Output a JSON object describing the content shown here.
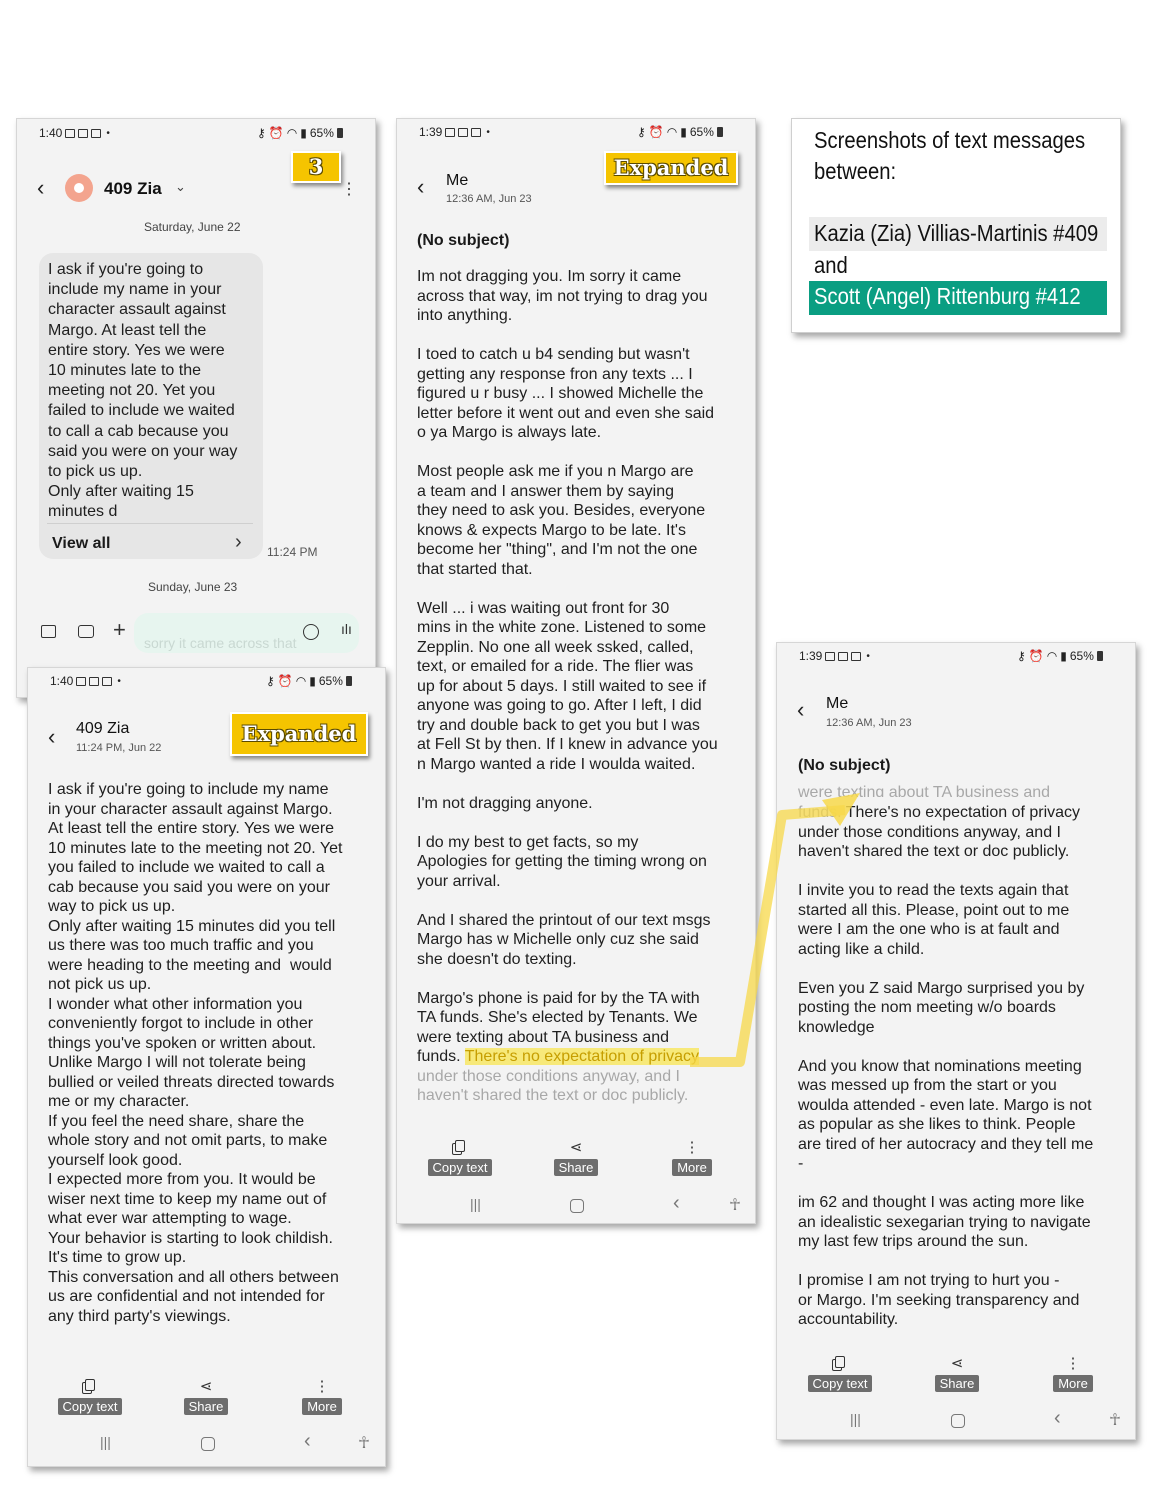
{
  "panel1": {
    "status_time": "1:40",
    "status_battery": "65%",
    "contact_name": "409 Zia",
    "badge": "3",
    "date_1": "Saturday, June 22",
    "message": "I ask if you're going to\ninclude my name in your\ncharacter assault against\nMargo. At least tell the\nentire story. Yes we were\n10 minutes late to the\nmeeting not 20. Yet you\nfailed to include we waited\nto call a cab because you\nsaid you were on your way\nto pick us up.\nOnly after waiting 15\nminutes d",
    "view_all": "View all",
    "msg_time": "11:24 PM",
    "date_2": "Sunday, June 23",
    "input_text": "sorry it came across that"
  },
  "panel2": {
    "status_time": "1:40",
    "status_battery": "65%",
    "sender": "409 Zia",
    "sub": "11:24 PM, Jun 22",
    "badge": "Expanded",
    "message": "I ask if you're going to include my name\nin your character assault against Margo.\nAt least tell the entire story. Yes we were\n10 minutes late to the meeting not 20. Yet\nyou failed to include we waited to call a\ncab because you said you were on your\nway to pick us up.\nOnly after waiting 15 minutes did you tell\nus there was too much traffic and you\nwere heading to the meeting and  would\nnot pick us up.\nI wonder what other information you\nconveniently forgot to include in other\nthings you've spoken or written about.\nUnlike Margo I will not tolerate being\nbullied or veiled threats directed towards\nme or my character.\nIf you feel the need share, share the\nwhole story and not omit parts, to make\nyourself look good.\nI expected more from you. It would be\nwiser next time to keep my name out of\nwhat ever war attempting to wage.\nYour behavior is starting to look childish.\nIt's time to grow up.\nThis conversation and all others between\nus are confidential and not intended for\nany third party's viewings.",
    "copy": "Copy text",
    "share": "Share",
    "more": "More"
  },
  "panel3": {
    "status_time": "1:39",
    "status_battery": "65%",
    "sender": "Me",
    "sub": "12:36 AM, Jun 23",
    "badge": "Expanded",
    "subject": "(No subject)",
    "message": "Im not dragging you. Im sorry it came\nacross that way, im not trying to drag you\ninto anything.\n\nI toed to catch u b4 sending but wasn't\ngetting any response fron any texts ... I\nfigured u r busy ... I showed Michelle the\nletter before it went out and even she said\no ya Margo is always late.\n\nMost people ask me if you n Margo are\na team and I answer them by saying\nthey need to ask you. Besides, everyone\nknows & expects Margo to be late. It's\nbecome her \"thing\", and I'm not the one\nthat started that.\n\nWell ... i was waiting out front for 30\nmins in the white zone. Listened to some\nZepplin. No one all week ssked, called,\ntext, or emailed for a ride. The flier was\nup for about 5 days. I still waited to see if\nanyone was going to go. After I left, I did\ntry and double back to get you but I was\nat Fell St by then. If I knew in advance you\nn Margo wanted a ride I woulda waited.\n\nI'm not dragging anyone.\n\nI do my best to get facts, so my\nApologies for getting the timing wrong on\nyour arrival.\n\nAnd I shared the printout of our text msgs\nMargo has w Michelle only cuz she said\nshe doesn't do texting.\n\nMargo's phone is paid for by the TA with\nTA funds. She's elected by Tenants. We\nwere texting about TA business and\nfunds.",
    "highlight": "There's no expectation of privacy",
    "faded": "under those conditions anyway, and I\nhaven't shared the text or doc publicly.",
    "copy": "Copy text",
    "share": "Share",
    "more": "More"
  },
  "panel4": {
    "status_time": "1:39",
    "status_battery": "65%",
    "sender": "Me",
    "sub": "12:36 AM, Jun 23",
    "subject": "(No subject)",
    "faded_top": "were texting about TA business and",
    "funds": "funds.",
    "message_first": " There's no expectation of privacy\nunder those conditions anyway, and I\nhaven't shared the text or doc publicly.",
    "message": "I invite you to read the texts again that\nstarted all this. Please, point out to me\nwere I am the one who is at fault and\nacting like a child.\n\nEven you Z said Margo surprised you by\nposting the nom meeting w/o boards\nknowledge\n\nAnd you know that nominations meeting\nwas messed up from the start or you\nwoulda attended - even late. Margo is not\nas popular as she likes to think. People\nare tired of her autocracy and they tell me\n-\n\nim 62 and thought I was acting more like\nan idealistic sexegarian trying to navigate\nmy last few trips around the sun.\n\nI promise I am not trying to hurt you -\nor Margo. I'm seeking transparency and\naccountability.",
    "copy": "Copy text",
    "share": "Share",
    "more": "More"
  },
  "caption": {
    "line1": "Screenshots of text messages",
    "line2": "between:",
    "name1": "Kazia (Zia) Villias-Martinis #409",
    "and": "and",
    "name2": "Scott (Angel) Rittenburg #412",
    "name1_bg": "#ececec",
    "name2_bg": "#0a9e82"
  },
  "colors": {
    "badge": "#f5c400",
    "arrow": "#f7d84a",
    "highlight_text": "#c69e00"
  }
}
